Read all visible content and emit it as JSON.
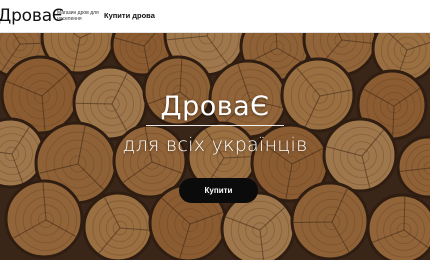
{
  "header": {
    "logo": "ДроваЄ",
    "tagline": "Магазин дров для населення",
    "nav": {
      "buy_link": "Купити дрова"
    }
  },
  "hero": {
    "title": "ДроваЄ",
    "subtitle": "для всіх українців",
    "button_label": "Купити",
    "background": "firewood-stack-photo"
  },
  "colors": {
    "header_bg": "#ffffff",
    "button_bg": "#0b0b0b",
    "button_text": "#ffffff",
    "wood_light": "#d49a5c",
    "wood_dark": "#3a2415"
  }
}
